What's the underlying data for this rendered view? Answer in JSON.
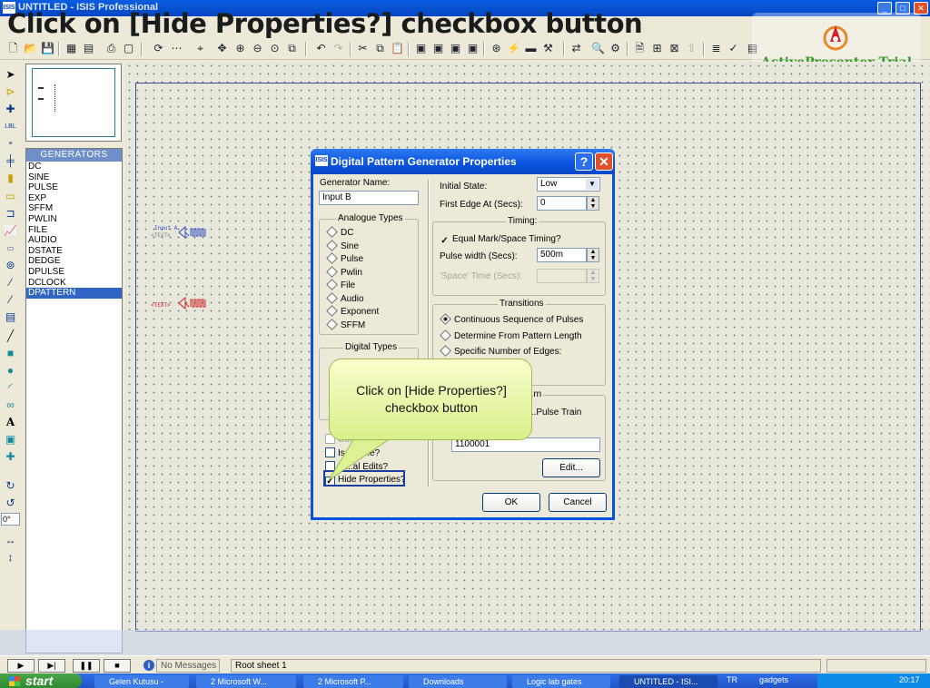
{
  "window": {
    "title": "UNTITLED - ISIS Professional",
    "icon_text": "ISIS"
  },
  "slide": {
    "title": "Click on [Hide Properties?] checkbox button"
  },
  "watermark": {
    "text": "ActivePresenter Trial"
  },
  "devices": {
    "header": "GENERATORS",
    "items": [
      "DC",
      "SINE",
      "PULSE",
      "EXP",
      "SFFM",
      "PWLIN",
      "FILE",
      "AUDIO",
      "DSTATE",
      "DEDGE",
      "DPULSE",
      "DCLOCK",
      "DPATTERN"
    ],
    "selected": "DPATTERN"
  },
  "canvas": {
    "gen1_label": "Input A",
    "gen1_text": "<TEXT>",
    "gen2_text": "<TEXT>"
  },
  "rotation": {
    "value": "0°"
  },
  "statusbar": {
    "messages": "No Messages",
    "sheet": "Root sheet 1"
  },
  "taskbar": {
    "start": "start",
    "tasks": [
      "Gelen Kutusu -",
      "2 Microsoft W...",
      "2 Microsoft P...",
      "Downloads",
      "Logic lab gates",
      "UNTITLED - ISI...",
      "TR",
      "gadgets"
    ],
    "clock": "20:17"
  },
  "dialog": {
    "title": "Digital Pattern Generator Properties",
    "icon_text": "ISIS",
    "help": "?",
    "close": "✕",
    "generator_name_label": "Generator Name:",
    "generator_name_value": "Input B",
    "analogue_title": "Analogue Types",
    "analogue_types": [
      "DC",
      "Sine",
      "Pulse",
      "Pwlin",
      "File",
      "Audio",
      "Exponent",
      "SFFM"
    ],
    "digital_title": "Digital Types",
    "initial_state_label": "Initial State:",
    "initial_state_value": "Low",
    "first_edge_label": "First Edge At (Secs):",
    "first_edge_value": "0",
    "timing_title": "Timing:",
    "equal_mark_label": "Equal Mark/Space Timing?",
    "pulse_width_label": "Pulse width (Secs):",
    "pulse_width_value": "500m",
    "space_time_label": "'Space' Time (Secs):",
    "space_time_value": "",
    "transitions_title": "Transitions",
    "transitions": [
      "Continuous Sequence of Pulses",
      "Determine From Pattern Length",
      "Specific Number of Edges:"
    ],
    "bit_pattern_title": "...rn",
    "pulse_train_label": "...Pulse Train",
    "pattern_value": "1100001",
    "edit_button": "Edit...",
    "current_label": "Curre...",
    "isolate_label": "Isol... ...e?",
    "manual_edits_label": "M...al Edits?",
    "hide_properties_label": "Hide Properties?",
    "ok_button": "OK",
    "cancel_button": "Cancel"
  },
  "callout": {
    "text": "Click on [Hide Properties?] checkbox button"
  }
}
